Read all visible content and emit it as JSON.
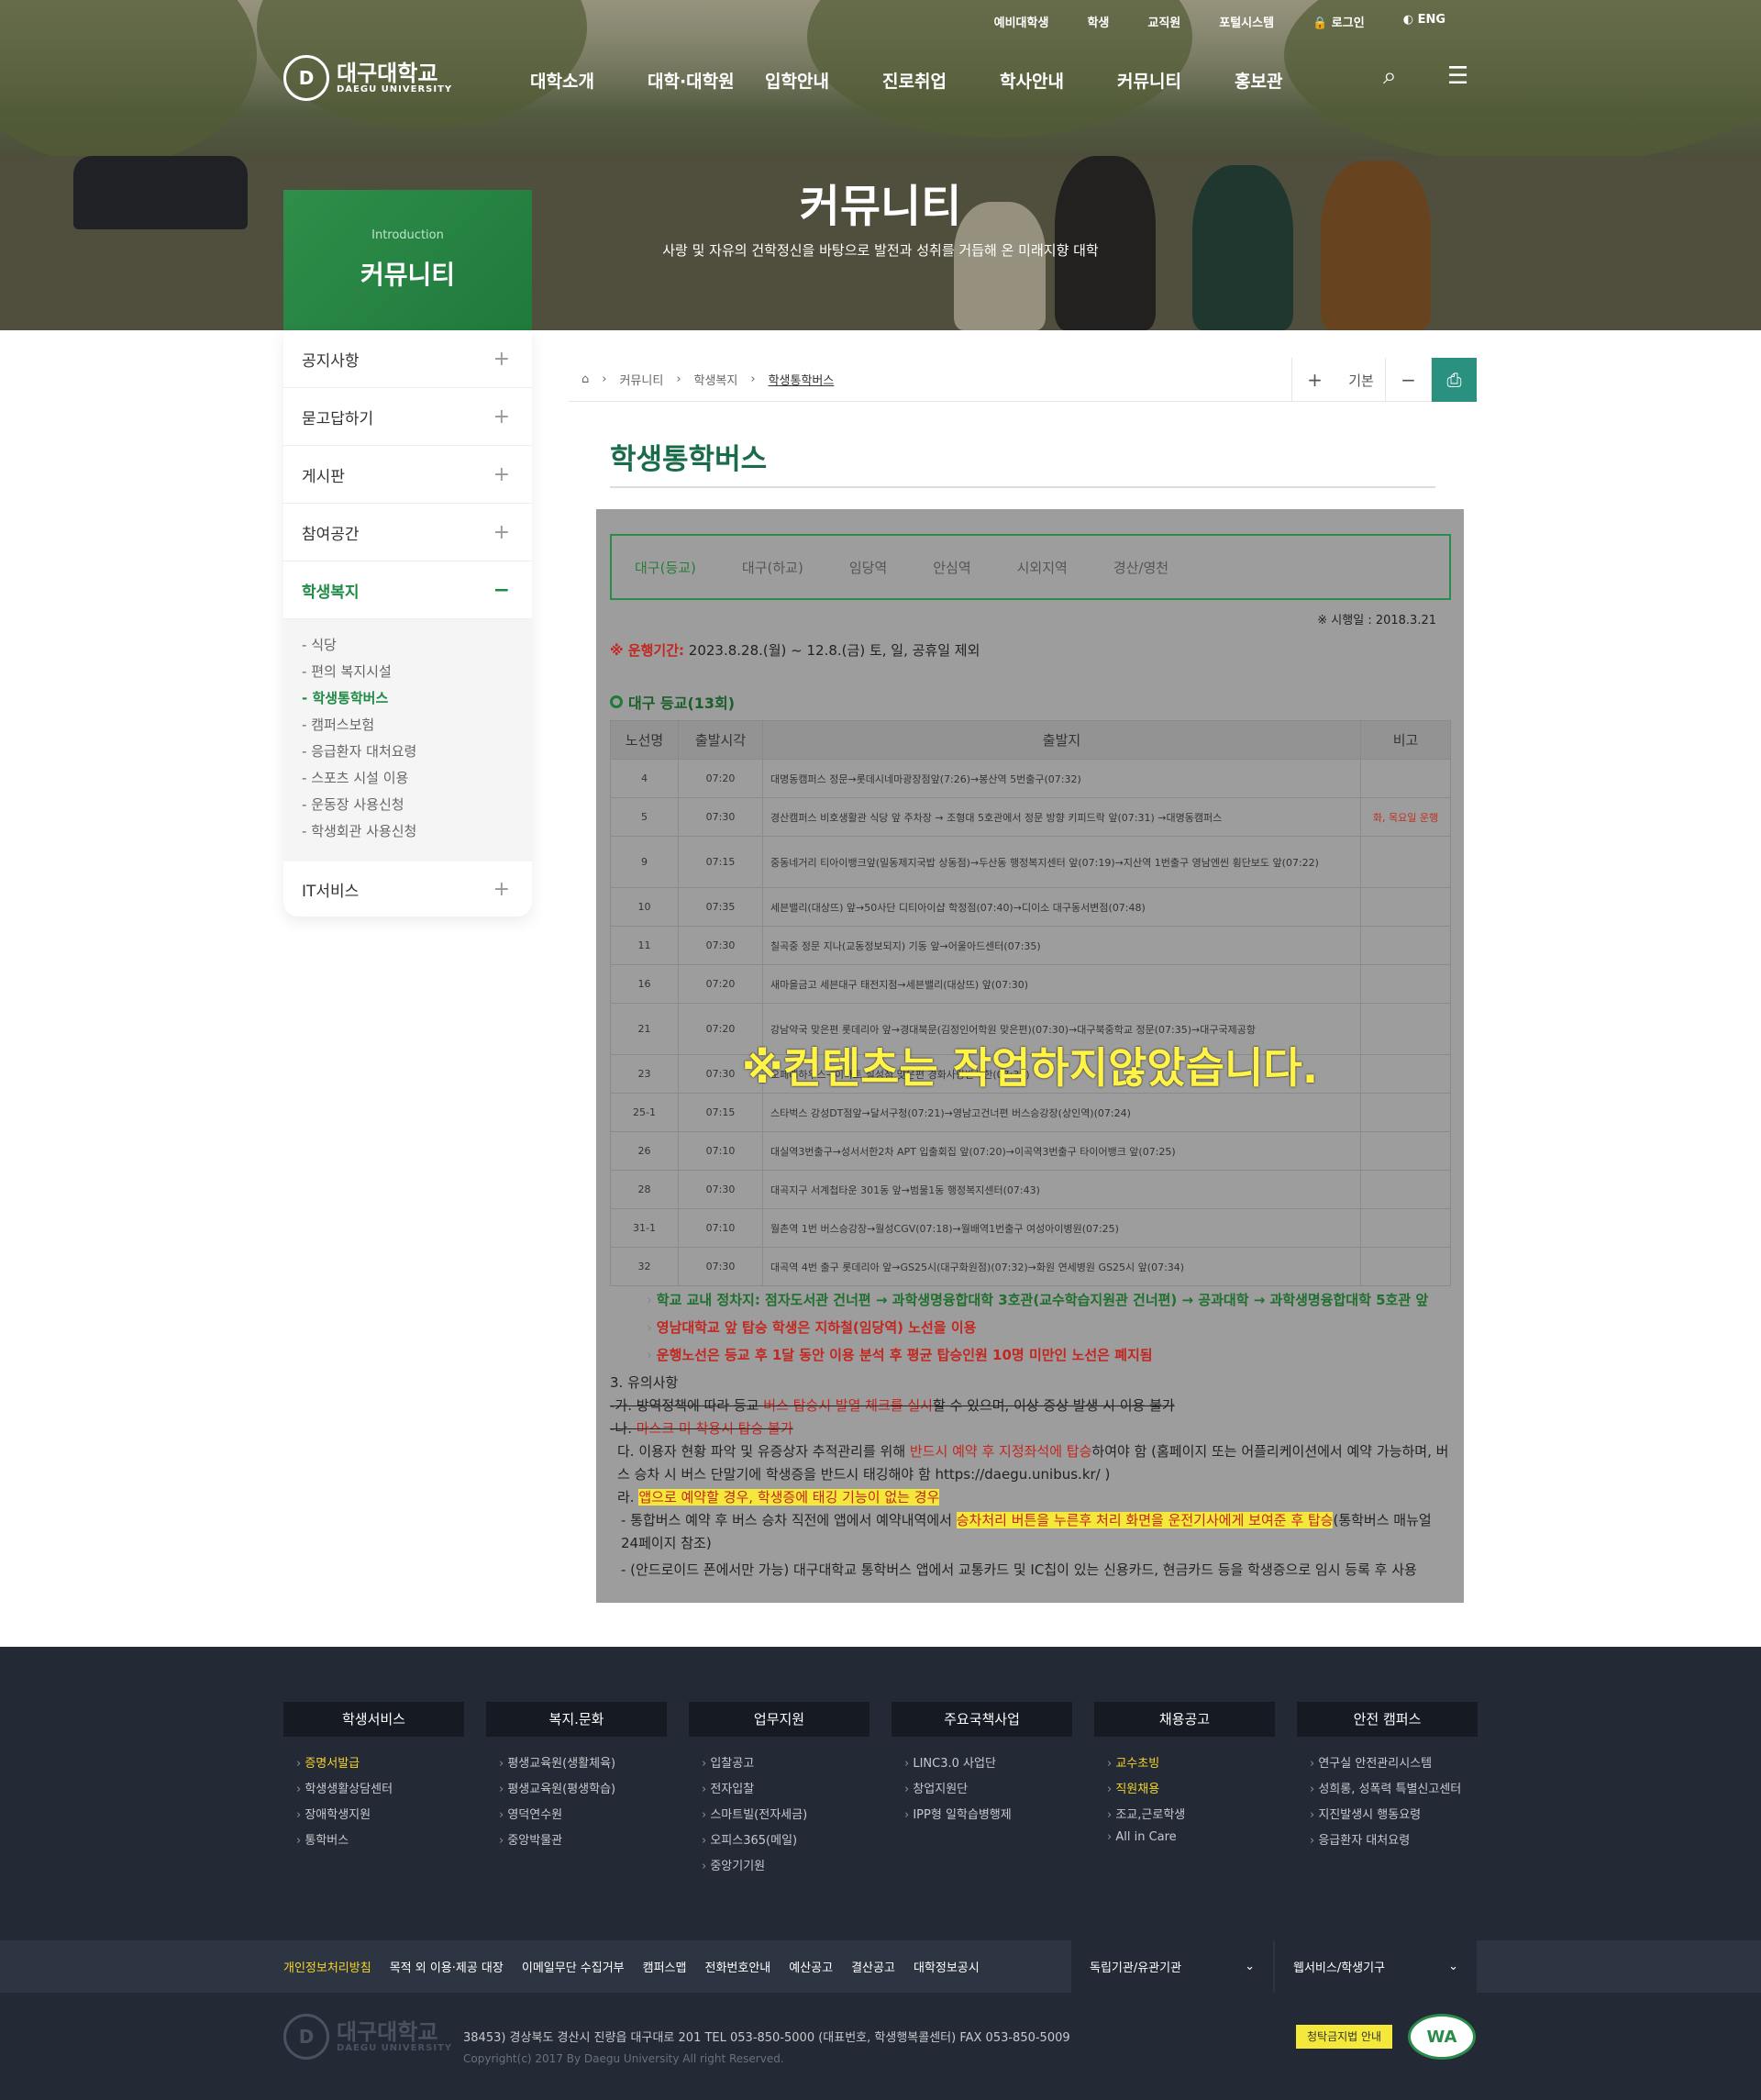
{
  "header": {
    "utility": [
      "예비대학생",
      "학생",
      "교직원",
      "포털시스템",
      "로그인",
      "ENG"
    ],
    "logo_ko": "대구대학교",
    "logo_en": "DAEGU UNIVERSITY",
    "gnb": [
      "대학소개",
      "대학·대학원",
      "입학안내",
      "진로취업",
      "학사안내",
      "커뮤니티",
      "홍보관"
    ],
    "hero_title": "커뮤니티",
    "hero_sub": "사랑 및 자유의 건학정신을 바탕으로 발전과 성취를 거듭해 온 미래지향 대학"
  },
  "lnb": {
    "intro": "Introduction",
    "title": "커뮤니티",
    "items": [
      "공지사항",
      "묻고답하기",
      "게시판",
      "참여공간",
      "학생복지",
      "IT서비스"
    ],
    "sub": [
      "식당",
      "편의 복지시설",
      "학생통학버스",
      "캠퍼스보험",
      "응급환자 대처요령",
      "스포츠 시설 이용",
      "운동장 사용신청",
      "학생회관 사용신청"
    ]
  },
  "breadcrumb": [
    "커뮤니티",
    "학생복지",
    "학생통학버스"
  ],
  "zoom": {
    "plus": "+",
    "base": "기본",
    "minus": "−"
  },
  "page_title": "학생통학버스",
  "tabs": [
    "대구(등교)",
    "대구(하교)",
    "임당역",
    "안심역",
    "시외지역",
    "경산/영천"
  ],
  "effective_date": "※ 시행일 : 2018.3.21",
  "period_label": "※ 운행기간:",
  "period_value": " 2023.8.28.(월) ~ 12.8.(금)  토, 일, 공휴일 제외",
  "section_title": "대구 등교(13회)",
  "table": {
    "headers": [
      "노선명",
      "출발시각",
      "출발지",
      "비고"
    ],
    "rows": [
      [
        "4",
        "07:20",
        "대명동캠퍼스 정문→롯데시네마광장점앞(7:26)→봉산역 5번출구(07:32)",
        ""
      ],
      [
        "5",
        "07:30",
        "경산캠퍼스 비호생활관 식당 앞 주차장 → 조형대 5호관에서 정문 방향 키피드락 앞(07:31) →대명동캠퍼스",
        "화, 목요일 운행"
      ],
      [
        "9",
        "07:15",
        "중동네거리 티아이뱅크앞(밀동제지국밥 상동점)→두산동 행정복지센터 앞(07:19)→지산역 1번출구 영남엔씬 횡단보도 앞(07:22)",
        ""
      ],
      [
        "10",
        "07:35",
        "세븐밸리(대상뜨) 앞→50사단 디티아이샵 학정점(07:40)→디이소 대구동서변점(07:48)",
        ""
      ],
      [
        "11",
        "07:30",
        "칠곡중 정문 지나(교동정보되지) 기동 앞→어울아드센터(07:35)",
        ""
      ],
      [
        "16",
        "07:20",
        "새마을금고 세븐대구 태전지점→세븐밸리(대상뜨) 앞(07:30)",
        ""
      ],
      [
        "21",
        "07:20",
        "강남약국 맞은편 롯데리아 앞→경대북문(김정인어학원 맞은편)(07:30)→대구북중학교 정문(07:35)→대구국제공항",
        ""
      ],
      [
        "23",
        "07:30",
        "오페레하우스→이마트 칠성점 맞은편 경화사랑반석한(07:33)",
        ""
      ],
      [
        "25-1",
        "07:15",
        "스타벅스 강성DT점앞→달서구청(07:21)→영남고건너편 버스승강장(상인역)(07:24)",
        ""
      ],
      [
        "26",
        "07:10",
        "대실역3번출구→성서서한2차 APT 입출회집 앞(07:20)→이곡역3번출구 타이어뱅크 앞(07:25)",
        ""
      ],
      [
        "28",
        "07:30",
        "대곡지구 서계첩타운 301동 앞→범물1동 행정복지센터(07:43)",
        ""
      ],
      [
        "31-1",
        "07:10",
        "월촌역 1번 버스승강장→월성CGV(07:18)→월배역1번출구 여성아이병원(07:25)",
        ""
      ],
      [
        "32",
        "07:30",
        "대곡역 4번 출구 롯데리아 앞→GS25시(대구화원점)(07:32)→화원 연세병원 GS25시 앞(07:34)",
        ""
      ]
    ]
  },
  "overlay": "※컨텐츠는 작업하지않았습니다.",
  "notes": {
    "n1": "학교 교내 정차지: 점자도서관 건너편 → 과학생명융합대학 3호관(교수학습지원관 건너편) → 공과대학 → 과학생명융합대학 5호관 앞",
    "n2": "영남대학교 앞 탑승 학생은 지하철(임당역) 노선을 이용",
    "n3": "운행노선은 등교 후 1달 동안 이용 분석 후 평균 탑승인원 10명 미만인 노선은 폐지됨",
    "h": "3. 유의사항",
    "a1": "-가. 방역정책에 따라 등교 ",
    "a2": "버스 탑승시 발열 체크를 실시",
    "a3": "할 수 있으며, 이상 증상 발생 시 이용 불가",
    "b1": "-나. ",
    "b2": "마스크 미 착용시 탑승 불가",
    "c1": "다. 이용자 현황 파악 및 유증상자 추적관리를 위해 ",
    "c2": "반드시 예약 후 지정좌석에 탑승",
    "c3": "하여야 함 (홈페이지 또는 어플리케이션에서 예약 가능하며, 버스 승차 시 버스 단말기에 학생증을 반드시 태깅해야 함 https://daegu.unibus.kr/ )",
    "d1": "라. ",
    "d2": "앱으로 예약할 경우, 학생증에 태깅 기능이 없는 경우",
    "e1": "- 통합버스 예약 후 버스 승차 직전에 앱에서 예약내역에서 ",
    "e2": "승차처리 버튼을 누른후 처리 화면을 운전기사에게 보여준 후 탑승",
    "e3": "(통학버스 매뉴얼 24페이지 참조)",
    "f": "- (안드로이드 폰에서만 가능) 대구대학교 통학버스 앱에서 교통카드 및 IC칩이 있는 신용카드, 현금카드 등을 학생증으로 임시 등록 후 사용"
  },
  "footer": {
    "cols": [
      {
        "title": "학생서비스",
        "items": [
          "증명서발급",
          "학생생활상담센터",
          "장애학생지원",
          "통학버스"
        ],
        "hl": [
          0
        ]
      },
      {
        "title": "복지.문화",
        "items": [
          "평생교육원(생활체육)",
          "평생교육원(평생학습)",
          "영덕연수원",
          "중앙박물관"
        ],
        "hl": []
      },
      {
        "title": "업무지원",
        "items": [
          "입찰공고",
          "전자입찰",
          "스마트빌(전자세금)",
          "오피스365(메일)",
          "중앙기기원"
        ],
        "hl": []
      },
      {
        "title": "주요국책사업",
        "items": [
          "LINC3.0 사업단",
          "창업지원단",
          "IPP형 일학습병행제"
        ],
        "hl": []
      },
      {
        "title": "채용공고",
        "items": [
          "교수초빙",
          "직원채용",
          "조교,근로학생",
          "All in Care"
        ],
        "hl": [
          0,
          1
        ]
      },
      {
        "title": "안전 캠퍼스",
        "items": [
          "연구실 안전관리시스템",
          "성희롱, 성폭력 특별신고센터",
          "지진발생시 행동요령",
          "응급환자 대처요령"
        ],
        "hl": []
      }
    ],
    "links": [
      "개인정보처리방침",
      "목적 외 이용·제공 대장",
      "이메일무단 수집거부",
      "캠퍼스맵",
      "전화번호안내",
      "예산공고",
      "결산공고",
      "대학정보공시"
    ],
    "select1": "독립기관/유관기관",
    "select2": "웹서비스/학생기구",
    "address": "38453) 경상북도 경산시 진량읍 대구대로 201   TEL  053-850-5000 (대표번호, 학생행복콜센터)   FAX  053-850-5009",
    "copyright": "Copyright(c) 2017 By Daegu University All right Reserved.",
    "btn": "청탁금지법 안내",
    "wa": "WA"
  }
}
